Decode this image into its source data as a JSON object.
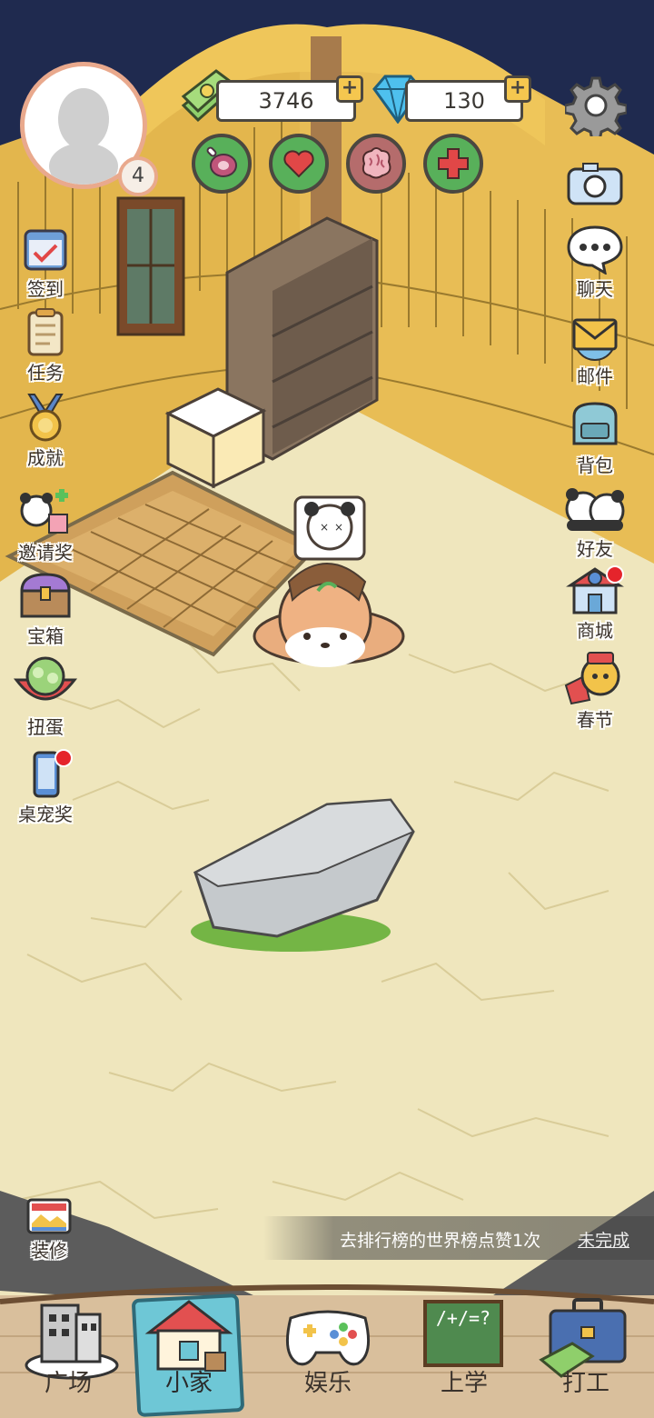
{
  "profile": {
    "level": "4",
    "avatar": "default-avatar"
  },
  "currency": {
    "money": "3746",
    "diamonds": "130"
  },
  "stats": [
    {
      "name": "food",
      "icon": "meat-icon"
    },
    {
      "name": "love",
      "icon": "heart-icon"
    },
    {
      "name": "brain",
      "icon": "brain-icon"
    },
    {
      "name": "health",
      "icon": "medical-cross-icon"
    }
  ],
  "left_menu": [
    {
      "id": "checkin",
      "label": "签到"
    },
    {
      "id": "tasks",
      "label": "任务"
    },
    {
      "id": "achievements",
      "label": "成就"
    },
    {
      "id": "invite",
      "label": "邀请奖"
    },
    {
      "id": "chest",
      "label": "宝箱"
    },
    {
      "id": "gacha",
      "label": "扭蛋"
    },
    {
      "id": "desktop-pet",
      "label": "桌宠奖"
    }
  ],
  "right_menu": [
    {
      "id": "camera",
      "label": ""
    },
    {
      "id": "chat",
      "label": "聊天"
    },
    {
      "id": "mail",
      "label": "邮件"
    },
    {
      "id": "bag",
      "label": "背包"
    },
    {
      "id": "friends",
      "label": "好友"
    },
    {
      "id": "shop",
      "label": "商城"
    },
    {
      "id": "spring-festival",
      "label": "春节"
    }
  ],
  "decorate": {
    "label": "装修"
  },
  "task_banner": {
    "text": "去排行榜的世界榜点赞1次",
    "status": "未完成"
  },
  "bottom_nav": [
    {
      "id": "plaza",
      "label": "广场"
    },
    {
      "id": "home",
      "label": "小家",
      "active": true
    },
    {
      "id": "entertainment",
      "label": "娱乐"
    },
    {
      "id": "school",
      "label": "上学"
    },
    {
      "id": "work",
      "label": "打工"
    }
  ],
  "school_board_text": "/+/=?",
  "colors": {
    "sky": "#1f2a4f",
    "floor": "#efe6bd",
    "thatch": "#e3b64d",
    "accent_green": "#58b05a",
    "badge_red": "#e5242b"
  }
}
